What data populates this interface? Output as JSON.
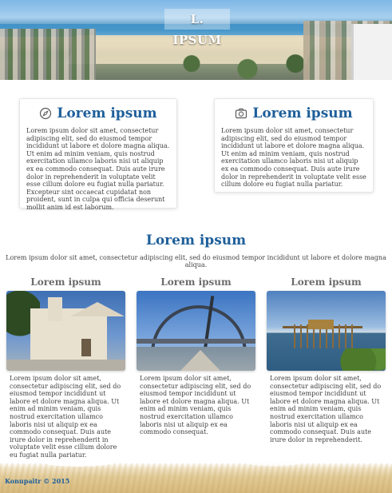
{
  "hero": {
    "title": "L. IPSUM"
  },
  "cards": [
    {
      "icon": "compass-icon",
      "heading": "Lorem ipsum",
      "text": "Lorem ipsum dolor sit amet, consectetur adipiscing elit, sed do eiusmod tempor incididunt ut labore et dolore magna aliqua. Ut enim ad minim veniam, quis nostrud exercitation ullamco laboris nisi ut aliquip ex ea commodo consequat. Duis aute irure dolor in reprehenderit in voluptate velit esse cillum dolore eu fugiat nulla pariatur. Excepteur sint occaecat cupidatat non proident, sunt in culpa qui officia deserunt mollit anim id est laborum."
    },
    {
      "icon": "camera-icon",
      "heading": "Lorem ipsum",
      "text": "Lorem ipsum dolor sit amet, consectetur adipiscing elit, sed do eiusmod tempor incididunt ut labore et dolore magna aliqua. Ut enim ad minim veniam, quis nostrud exercitation ullamco laboris nisi ut aliquip ex ea commodo consequat. Duis aute irure dolor in reprehenderit in voluptate velit esse cillum dolore eu fugiat nulla pariatur."
    }
  ],
  "section": {
    "title": "Lorem ipsum",
    "subtitle": "Lorem ipsum dolor sit amet, consectetur adipiscing elit, sed do eiusmod tempor incididunt ut labore et dolore magna aliqua."
  },
  "columns": [
    {
      "heading": "Lorem ipsum",
      "text": "Lorem ipsum dolor sit amet, consectetur adipiscing elit, sed do eiusmod tempor incididunt ut labore et dolore magna aliqua. Ut enim ad minim veniam, quis nostrud exercitation ullamco laboris nisi ut aliquip ex ea commodo consequat. Duis aute irure dolor in reprehenderit in voluptate velit esse cillum dolore eu fugiat nulla pariatur."
    },
    {
      "heading": "Lorem ipsum",
      "text": "Lorem ipsum dolor sit amet, consectetur adipiscing elit, sed do eiusmod tempor incididunt ut labore et dolore magna aliqua. Ut enim ad minim veniam, quis nostrud exercitation ullamco laboris nisi ut aliquip ex ea commodo consequat."
    },
    {
      "heading": "Lorem ipsum",
      "text": "Lorem ipsum dolor sit amet, consectetur adipiscing elit, sed do eiusmod tempor incididunt ut labore et dolore magna aliqua. Ut enim ad minim veniam, quis nostrud exercitation ullamco laboris nisi ut aliquip ex ea commodo consequat. Duis aute irure dolor in reprehenderit."
    }
  ],
  "footer": {
    "copyright": "Konupaitr © 2015"
  },
  "colors": {
    "accent": "#1e5f9a",
    "heading_gray": "#6c6c6c",
    "body_text": "#3f3f3f"
  }
}
